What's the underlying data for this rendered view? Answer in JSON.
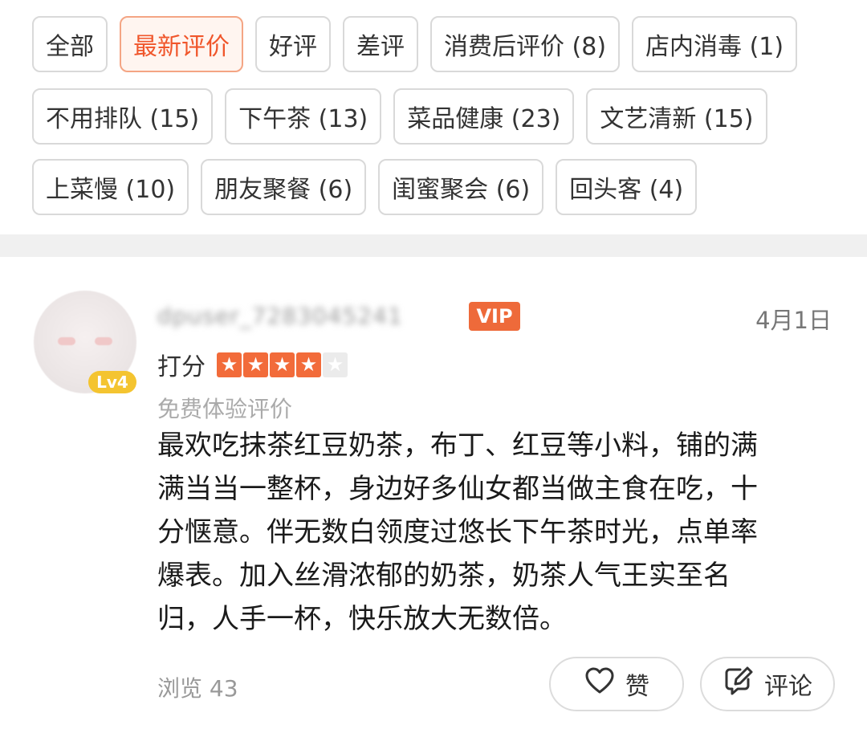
{
  "tags": {
    "row1": [
      "全部",
      "最新评价",
      "好评",
      "差评",
      "消费后评价 (8)",
      "店内消毒 (1)"
    ],
    "row2": [
      "不用排队 (15)",
      "下午茶 (13)",
      "菜品健康 (23)",
      "文艺清新 (15)"
    ],
    "row3": [
      "上菜慢 (10)",
      "朋友聚餐 (6)",
      "闺蜜聚会 (6)",
      "回头客 (4)"
    ],
    "active": "最新评价"
  },
  "review": {
    "username": "dpuser_7283045241",
    "vip_label": "VIP",
    "level_label": "Lv4",
    "date": "4月1日",
    "rating_label": "打分",
    "rating": 4,
    "rating_max": 5,
    "subtitle": "免费体验评价",
    "lines": [
      "最欢吃抹茶红豆奶茶，布丁、红豆等小料，铺的满",
      "满当当一整杯，身边好多仙女都当做主食在吃，十",
      "分惬意。伴无数白领度过悠长下午茶时光，点单率",
      "爆表。加入丝滑浓郁的奶茶，奶茶人气王实至名",
      "归，人手一杯，快乐放大无数倍。"
    ],
    "views": "浏览 43",
    "like_label": "赞",
    "comment_label": "评论"
  },
  "colors": {
    "accent": "#f0562b",
    "star": "#f26b3a",
    "vip": "#ee6a3a",
    "level": "#f4c430"
  },
  "icons": {
    "star": "star-icon",
    "like": "heart-icon",
    "comment": "comment-edit-icon"
  }
}
